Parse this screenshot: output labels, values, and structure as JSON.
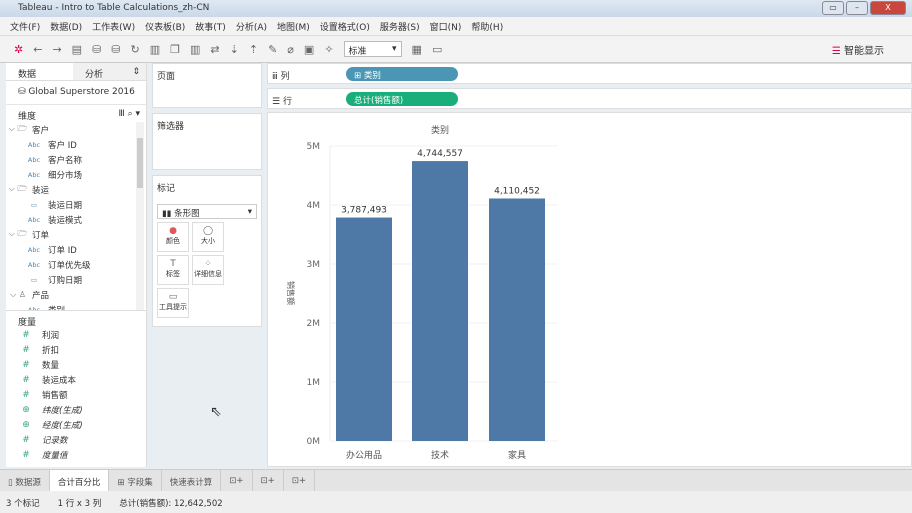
{
  "window": {
    "title": "Tableau - Intro to Table Calculations_zh-CN"
  },
  "menu": [
    "文件(F)",
    "数据(D)",
    "工作表(W)",
    "仪表板(B)",
    "故事(T)",
    "分析(A)",
    "地图(M)",
    "设置格式(O)",
    "服务器(S)",
    "窗口(N)",
    "帮助(H)"
  ],
  "toolbar": {
    "fit_select": "标准",
    "show_me": "智能显示"
  },
  "left": {
    "tab_data": "数据",
    "tab_analysis": "分析",
    "datasource": "Global Superstore 2016",
    "dimensions_label": "维度",
    "measures_label": "度量",
    "dimensions": [
      {
        "type": "folder",
        "name": "客户"
      },
      {
        "type": "abc",
        "name": "客户 ID"
      },
      {
        "type": "abc",
        "name": "客户名称"
      },
      {
        "type": "abc",
        "name": "细分市场"
      },
      {
        "type": "folder",
        "name": "装运"
      },
      {
        "type": "date",
        "name": "装运日期"
      },
      {
        "type": "abc",
        "name": "装运模式"
      },
      {
        "type": "folder",
        "name": "订单"
      },
      {
        "type": "abc",
        "name": "订单 ID"
      },
      {
        "type": "abc",
        "name": "订单优先级"
      },
      {
        "type": "date",
        "name": "订购日期"
      },
      {
        "type": "hier",
        "name": "产品"
      },
      {
        "type": "abc",
        "name": "类别"
      }
    ],
    "measures": [
      {
        "type": "num",
        "name": "利润"
      },
      {
        "type": "num",
        "name": "折扣"
      },
      {
        "type": "num",
        "name": "数量"
      },
      {
        "type": "num",
        "name": "装运成本"
      },
      {
        "type": "num",
        "name": "销售额"
      },
      {
        "type": "geo",
        "name": "纬度(生成)",
        "italic": true
      },
      {
        "type": "geo",
        "name": "经度(生成)",
        "italic": true
      },
      {
        "type": "num",
        "name": "记录数",
        "italic": true
      },
      {
        "type": "num",
        "name": "度量值",
        "italic": true
      }
    ]
  },
  "cards": {
    "pages": "页面",
    "filters": "筛选器",
    "marks": "标记",
    "mark_type": "条形图",
    "buttons": [
      "颜色",
      "大小",
      "标签",
      "详细信息",
      "工具提示"
    ]
  },
  "shelves": {
    "columns_label": "列",
    "columns_pill": "类别",
    "rows_label": "行",
    "rows_pill": "总计(销售额)"
  },
  "colors": {
    "bar": "#4e79a7",
    "dim_pill": "#4a96b4",
    "meas_pill": "#1aaf7a"
  },
  "chart_data": {
    "type": "bar",
    "title": "类别",
    "categories": [
      "办公用品",
      "技术",
      "家具"
    ],
    "values": [
      3787493,
      4744557,
      4110452
    ],
    "value_labels": [
      "3,787,493",
      "4,744,557",
      "4,110,452"
    ],
    "ylabel": "销售额",
    "ylim": [
      0,
      5000000
    ],
    "yticks": [
      "0M",
      "1M",
      "2M",
      "3M",
      "4M",
      "5M"
    ],
    "grid": true
  },
  "bottom_tabs": [
    "数据源",
    "合计百分比",
    "字段集",
    "快速表计算"
  ],
  "status": {
    "marks": "3 个标记",
    "dims": "1 行 x 3 列",
    "sum": "总计(销售额): 12,642,502"
  }
}
